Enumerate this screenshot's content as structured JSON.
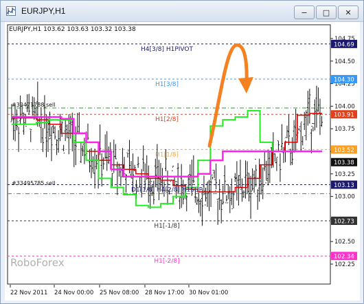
{
  "window": {
    "title": "EURJPY,H1",
    "minimize_label": "−",
    "maximize_label": "□",
    "close_label": "✕"
  },
  "chart": {
    "header": "EURJPY,H1  103.62 103.63 103.32 103.38",
    "watermark": "RoboForex",
    "price_labels": [
      {
        "text": "104.75",
        "price": 104.75
      },
      {
        "text": "104.50",
        "price": 104.5
      },
      {
        "text": "104.25",
        "price": 104.25
      },
      {
        "text": "104.00",
        "price": 104.0
      },
      {
        "text": "103.75",
        "price": 103.75
      },
      {
        "text": "103.50",
        "price": 103.5
      },
      {
        "text": "103.25",
        "price": 103.25
      },
      {
        "text": "103.00",
        "price": 103.0
      },
      {
        "text": "102.75",
        "price": 102.75
      },
      {
        "text": "102.50",
        "price": 102.5
      },
      {
        "text": "102.25",
        "price": 102.25
      }
    ],
    "time_labels": [
      "22 Nov 2011",
      "24 Nov 00:00",
      "25 Nov 08:00",
      "28 Nov 17:00",
      "30 Nov 01:00"
    ],
    "levels": [
      {
        "price": 104.69,
        "label": "H4[3/8] H1PIVOT",
        "badge": "104.69",
        "color": "#1a1a6e",
        "badge_bg": "#1a1a6e",
        "badge_fg": "#ffffff",
        "dash": "3,3"
      },
      {
        "price": 104.3,
        "label": "H1[3/8]",
        "badge": "104.30",
        "color": "#3399ff",
        "badge_bg": "#3399ff",
        "badge_fg": "#ffffff",
        "dash": "3,3"
      },
      {
        "price": 103.91,
        "label": "H1[2/8]",
        "badge": "103.91",
        "color": "#e0401a",
        "badge_bg": "#e0401a",
        "badge_fg": "#ffffff",
        "dash": "3,3"
      },
      {
        "price": 103.52,
        "label": "H1[1/8]",
        "badge": "103.52",
        "color": "#ffa020",
        "badge_bg": "#ffa020",
        "badge_fg": "#ffffff",
        "dash": "3,3"
      },
      {
        "price": 103.13,
        "label": "D1[1/8] H4[2/8] H1SUP",
        "badge": "103.13",
        "color": "#1a1a6e",
        "badge_bg": "#1a1a6e",
        "badge_fg": "#ffffff",
        "dash": "3,3"
      },
      {
        "price": 102.73,
        "label": "H1[-1/8]",
        "badge": "102.73",
        "color": "#333333",
        "badge_bg": "#333333",
        "badge_fg": "#ffffff",
        "dash": "3,3"
      },
      {
        "price": 102.34,
        "label": "H1[-2/8]",
        "badge": "102.34",
        "color": "#ff33cc",
        "badge_bg": "#ff33cc",
        "badge_fg": "#ffffff",
        "dash": "3,3"
      }
    ],
    "current_price": {
      "price": 103.38,
      "badge": "103.38",
      "badge_bg": "#111111",
      "badge_fg": "#ffffff"
    },
    "green_levels": [
      103.98,
      103.03
    ],
    "orders": [
      {
        "text": "#33471788 sell",
        "price": 103.98
      },
      {
        "text": "#33495785 sell",
        "price": 103.11
      }
    ],
    "colors": {
      "bars": "#111111",
      "green_line": "#22ee22",
      "magenta_line": "#ff22ee",
      "red_line": "#dd0000",
      "arrow": "#f58220",
      "grid_green": "#2a9a2a"
    },
    "price_min": 102.15,
    "price_max": 104.85,
    "bars_count": 180,
    "red_line": [
      103.87,
      103.87,
      103.85,
      103.8,
      103.7,
      103.6,
      103.5,
      103.4,
      103.35,
      103.3,
      103.25,
      103.2,
      103.18,
      103.12,
      103.08,
      103.05,
      103.05,
      103.05,
      103.1,
      103.2,
      103.35,
      103.5,
      103.6,
      103.9,
      103.92
    ],
    "magenta_line": [
      103.88,
      103.88,
      103.88,
      103.88,
      103.86,
      103.7,
      103.6,
      103.5,
      103.3,
      103.22,
      103.22,
      103.22,
      103.22,
      103.22,
      103.22,
      103.25,
      103.4,
      103.5,
      103.5,
      103.5,
      103.5,
      103.5,
      103.5,
      103.5,
      103.5
    ],
    "green_line": [
      103.8,
      103.8,
      103.82,
      103.85,
      103.85,
      103.6,
      103.4,
      103.2,
      103.1,
      103.02,
      102.9,
      102.88,
      102.92,
      103.0,
      103.1,
      103.4,
      103.78,
      103.85,
      103.88,
      103.95,
      103.6,
      103.5,
      103.5,
      103.5,
      103.5
    ]
  }
}
